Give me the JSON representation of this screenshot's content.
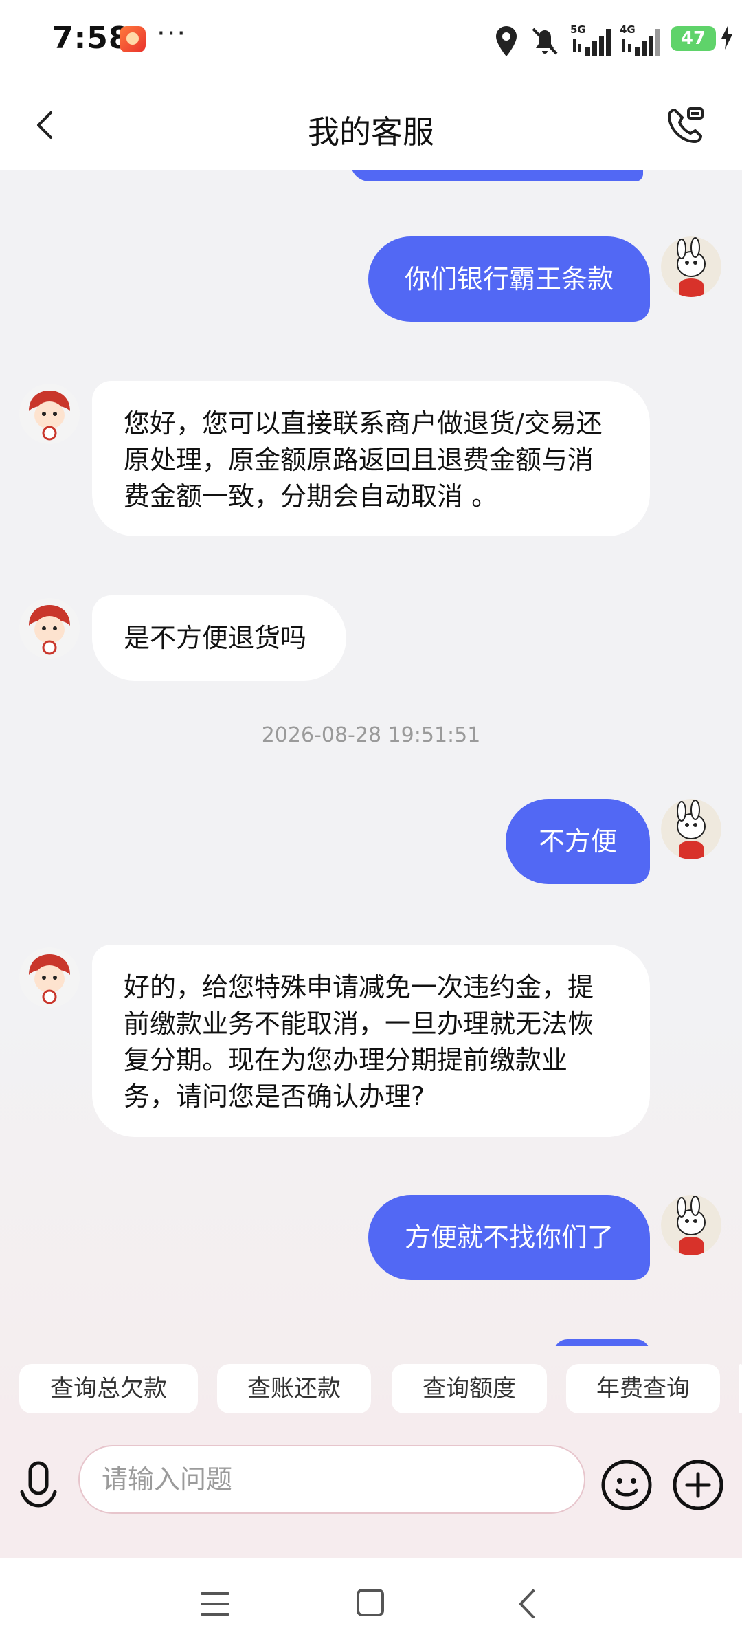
{
  "status_bar": {
    "time": "7:58",
    "dots": "···",
    "battery": "47",
    "network1": "5G",
    "network2": "4G"
  },
  "header": {
    "title": "我的客服"
  },
  "messages": [
    {
      "from": "user",
      "text": "你们银行霸王条款"
    },
    {
      "from": "bot",
      "text": "您好，您可以直接联系商户做退货/交易还原处理，原金额原路返回且退费金额与消费金额一致，分期会自动取消 。"
    },
    {
      "from": "bot",
      "text": "是不方便退货吗"
    },
    {
      "from": "user",
      "text": "不方便"
    },
    {
      "from": "bot",
      "text": "好的，给您特殊申请减免一次违约金，提前缴款业务不能取消，一旦办理就无法恢复分期。现在为您办理分期提前缴款业务，请问您是否确认办理?"
    },
    {
      "from": "user",
      "text": "方便就不找你们了"
    }
  ],
  "timestamp": "2026-08-28 19:51:51",
  "quick_replies": [
    "查询总欠款",
    "查账还款",
    "查询额度",
    "年费查询"
  ],
  "input": {
    "placeholder": "请输入问题"
  },
  "colors": {
    "user_bubble": "#5268f4",
    "bot_bubble": "#ffffff",
    "background": "#f2f2f4"
  }
}
